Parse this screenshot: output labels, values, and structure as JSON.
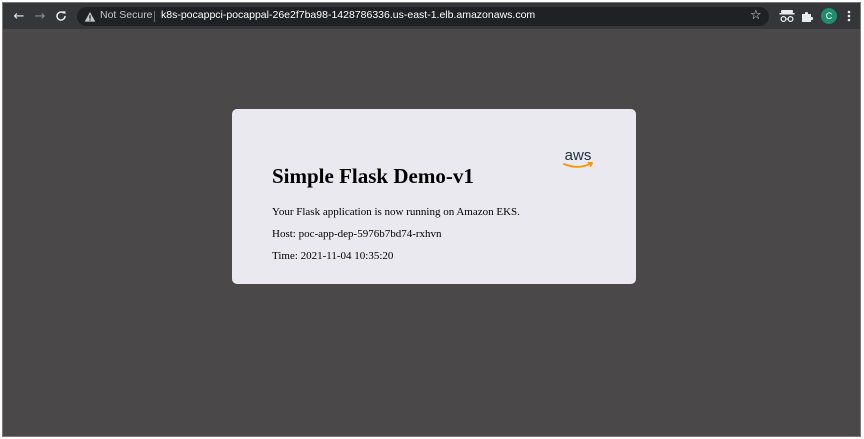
{
  "browser": {
    "security_label": "Not Secure",
    "url": "k8s-pocappci-pocappal-26e2f7ba98-1428786336.us-east-1.elb.amazonaws.com",
    "profile_initial": "C",
    "icons": [
      "back-arrow-icon",
      "forward-arrow-icon",
      "reload-icon",
      "warning-icon",
      "star-icon",
      "incognito-icon",
      "extensions-puzzle-icon",
      "more-vert-icon"
    ],
    "colors": {
      "toolbar": "#35363a",
      "omnibox": "#202124",
      "profile": "#1e8e6e"
    }
  },
  "page": {
    "background_color": "#4b4849",
    "card_color": "#e9e9ef",
    "logo_text": "aws",
    "logo_color": "#f79400",
    "title": "Simple Flask Demo-v1",
    "message": "Your Flask application is now running on Amazon EKS.",
    "host_line": "Host: poc-app-dep-5976b7bd74-rxhvn",
    "time_line": "Time: 2021-11-04 10:35:20"
  }
}
